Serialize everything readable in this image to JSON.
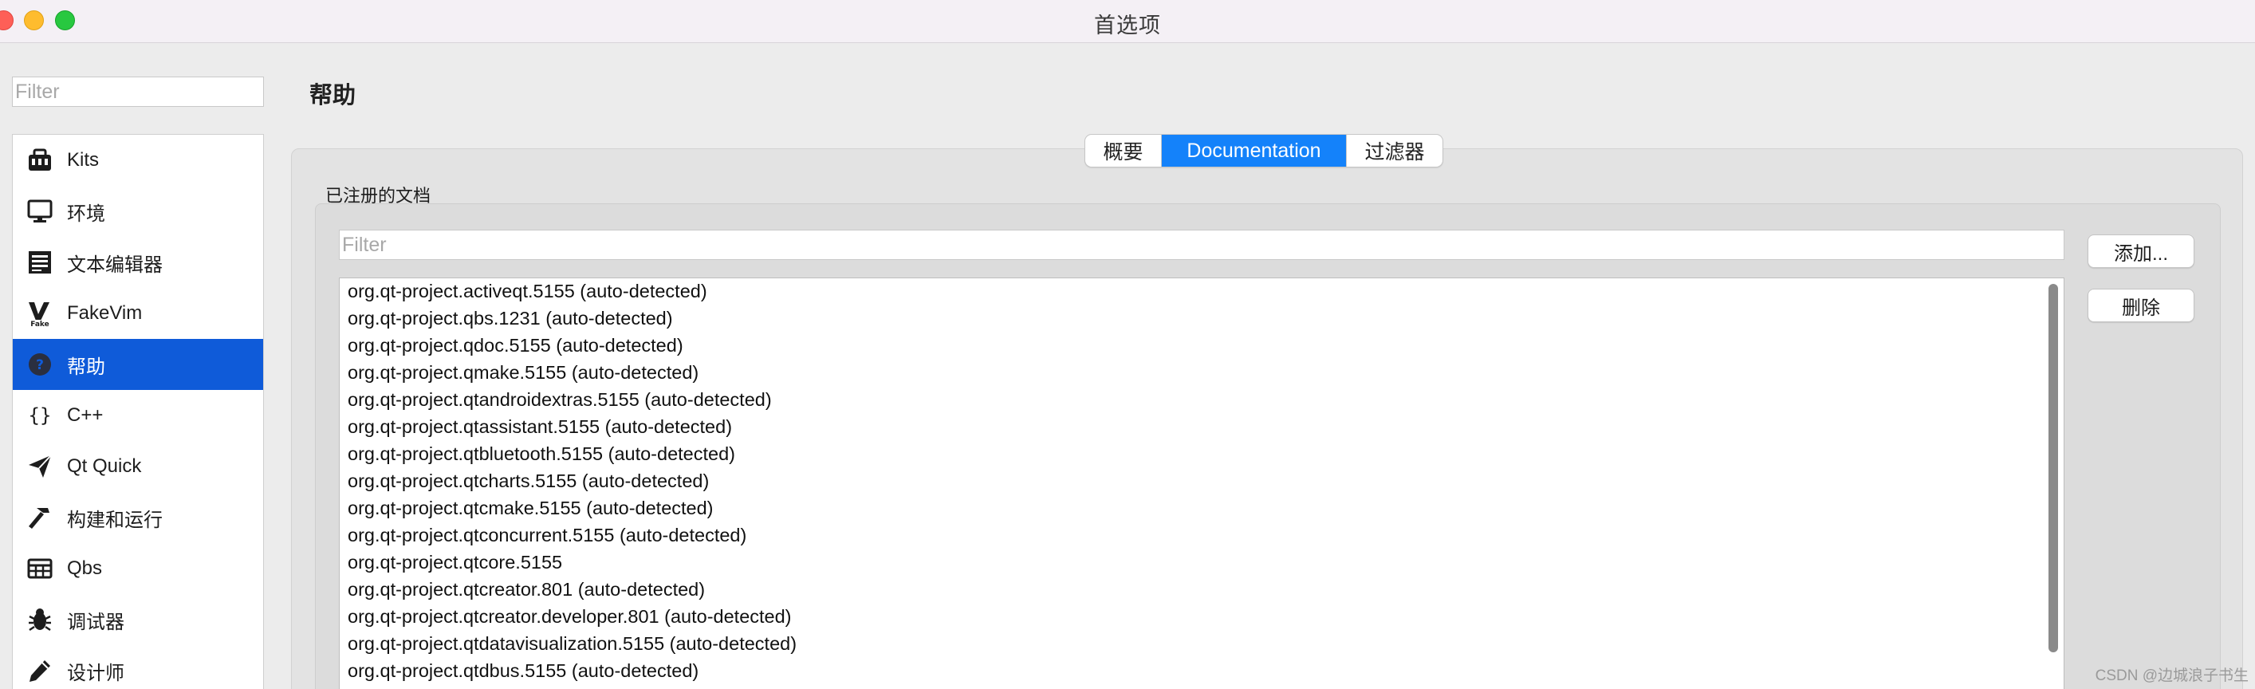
{
  "window": {
    "title": "首选项"
  },
  "sidebar": {
    "filter_placeholder": "Filter",
    "items": [
      {
        "label": "Kits",
        "icon": "kits-icon"
      },
      {
        "label": "环境",
        "icon": "monitor-icon"
      },
      {
        "label": "文本编辑器",
        "icon": "text-editor-icon"
      },
      {
        "label": "FakeVim",
        "icon": "fakevim-icon"
      },
      {
        "label": "帮助",
        "icon": "help-icon",
        "selected": true
      },
      {
        "label": "C++",
        "icon": "braces-icon"
      },
      {
        "label": "Qt Quick",
        "icon": "paper-plane-icon"
      },
      {
        "label": "构建和运行",
        "icon": "hammer-icon"
      },
      {
        "label": "Qbs",
        "icon": "qbs-icon"
      },
      {
        "label": "调试器",
        "icon": "bug-icon"
      },
      {
        "label": "设计师",
        "icon": "pen-icon"
      }
    ]
  },
  "page": {
    "title": "帮助"
  },
  "tabs": [
    {
      "label": "概要",
      "active": false
    },
    {
      "label": "Documentation",
      "active": true
    },
    {
      "label": "过滤器",
      "active": false
    }
  ],
  "docs": {
    "group_label": "已注册的文档",
    "filter_placeholder": "Filter",
    "add_label": "添加...",
    "remove_label": "删除",
    "items": [
      "org.qt-project.activeqt.5155 (auto-detected)",
      "org.qt-project.qbs.1231 (auto-detected)",
      "org.qt-project.qdoc.5155 (auto-detected)",
      "org.qt-project.qmake.5155 (auto-detected)",
      "org.qt-project.qtandroidextras.5155 (auto-detected)",
      "org.qt-project.qtassistant.5155 (auto-detected)",
      "org.qt-project.qtbluetooth.5155 (auto-detected)",
      "org.qt-project.qtcharts.5155 (auto-detected)",
      "org.qt-project.qtcmake.5155 (auto-detected)",
      "org.qt-project.qtconcurrent.5155 (auto-detected)",
      "org.qt-project.qtcore.5155",
      "org.qt-project.qtcreator.801 (auto-detected)",
      "org.qt-project.qtcreator.developer.801 (auto-detected)",
      "org.qt-project.qtdatavisualization.5155 (auto-detected)",
      "org.qt-project.qtdbus.5155 (auto-detected)"
    ]
  },
  "watermark": "CSDN @边城浪子书生",
  "colors": {
    "accent": "#1482fa",
    "selection": "#0f5bd9"
  }
}
